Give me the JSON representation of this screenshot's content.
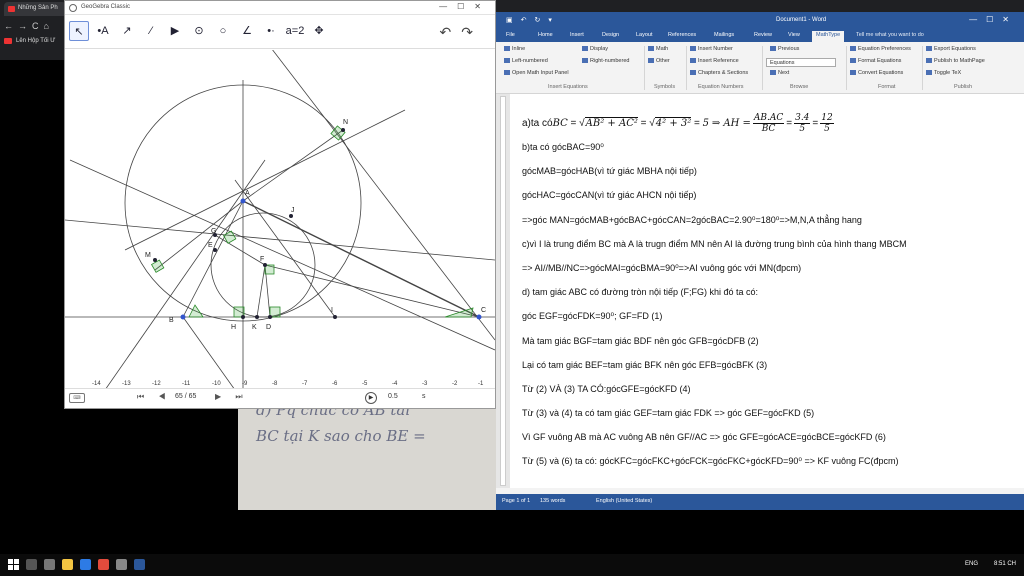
{
  "browser": {
    "tab_title": "Những Sản Ph",
    "nav_glyphs": "←→C⌂",
    "bookmark": "Lên Hộp Tối Ư"
  },
  "paper": {
    "line1": "d) Pq chúc co AB tai",
    "line2": "BC tại K sao cho BE ="
  },
  "geogebra": {
    "title": "GeoGebra Classic",
    "window_controls": "—☐✕",
    "tools": [
      "↖",
      "•A",
      "↗",
      "⁄",
      "▶",
      "⊙",
      "○",
      "∠",
      "•·",
      "a=2",
      "✥"
    ],
    "undo_redo": "↶↷",
    "keyboard": "⌨",
    "nav_controls": "⏮ ◀",
    "step_counter": "65 / 65",
    "nav_controls_end": "▶ ⏭",
    "play": "▶",
    "speed": "0.5",
    "speed_unit": "s",
    "axis_ticks": [
      "-14",
      "-13",
      "-12",
      "-11",
      "-10",
      "-9",
      "-8",
      "-7",
      "-6",
      "-5",
      "-4",
      "-3",
      "-2",
      "-1"
    ],
    "point_labels": [
      "N",
      "A",
      "J",
      "M",
      "G",
      "E",
      "F",
      "I",
      "B",
      "H",
      "K",
      "D",
      "C"
    ]
  },
  "word": {
    "quick_access": "▣↶↻▾",
    "title": "Document1 - Word",
    "window_controls": "—☐✕",
    "tabs": [
      "File",
      "Home",
      "Insert",
      "Design",
      "Layout",
      "References",
      "Mailings",
      "Review",
      "View",
      "MathType"
    ],
    "active_tab": "MathType",
    "tell_me": "Tell me what you want to do",
    "ribbon": {
      "inline": "Inline",
      "display": "Display",
      "math": "Math",
      "insert_number": "Insert Number",
      "previous": "Previous",
      "equation_prefs": "Equation Preferences",
      "export_equations": "Export Equations",
      "left_numbered": "Left-numbered",
      "right_numbered": "Right-numbered",
      "other": "Other",
      "insert_reference": "Insert Reference",
      "equations_dropdown": "Equations",
      "format_equations": "Format Equations",
      "publish_mathpage": "Publish to MathPage",
      "open_math_input": "Open Math Input Panel",
      "chapters_sections": "Chapters & Sections",
      "next": "Next",
      "convert_equations": "Convert Equations",
      "toggle_tex": "Toggle TeX",
      "groups": [
        "Insert Equations",
        "Symbols",
        "Equation Numbers",
        "Browse",
        "Format",
        "Publish"
      ]
    },
    "lines": [
      "a)ta có BC = √AB² + AC² = √4² + 3² = 5 ⇒ AH = AB.AC/BC = 3.4/5 = 12/5",
      "b)ta có gócBAC=90⁰",
      "gócMAB=gócHAB(vì tứ giác MBHA nội tiếp)",
      "gócHAC=gócCAN(vì tứ giác AHCN nội tiếp)",
      "=>góc MAN=gócMAB+gócBAC+gócCAN=2gócBAC=2.90⁰=180⁰=>M,N,A thẳng hang",
      "c)vì I là trung điểm BC mà A là trugn điểm MN nên AI là đường trung bình của hình thang MBCM",
      "=> AI//MB//NC=>gócMAI=gócBMA=90⁰=>AI vuông góc với MN(đpcm)",
      "d) tam giác ABC có đường tròn nội tiếp (F;FG) khi đó ta có:",
      "góc EGF=gócFDK=90⁰; GF=FD (1)",
      "Mà tam giác BGF=tam giác BDF nên góc GFB=gócDFB (2)",
      "Lại có tam giác BEF=tam giác BFK nên góc EFB=gócBFK (3)",
      "Từ (2) VÀ (3) TA CÓ:gócGFE=gócKFD (4)",
      "Từ (3) và (4) ta có tam giác GEF=tam giác FDK => góc GEF=gócFKD (5)",
      "Vì GF vuông AB mà AC vuông AB nên GF//AC => góc GFE=gócACE=gócBCE=gócKFD (6)",
      "Từ (5) và (6) ta có: gócKFC=gócFKC+gócFCK=gócFKC+gócKFD=90⁰ => KF vuông FC(đpcm)"
    ],
    "math_line": {
      "prefix": "a)ta có ",
      "bc": "BC",
      "eq": "=",
      "sqrt1": "AB² + AC²",
      "sqrt2": "4² + 3²",
      "five": "5",
      "ah_part": "⇒ AH =",
      "frac1_num": "AB.AC",
      "frac1_den": "BC",
      "frac2_num": "3.4",
      "frac2_den": "5",
      "frac3_num": "12",
      "frac3_den": "5"
    },
    "status": {
      "page": "Page 1 of 1",
      "words": "135 words",
      "language": "English (United States)"
    }
  },
  "taskbar": {
    "language": "ENG",
    "time": "8:51 CH"
  }
}
